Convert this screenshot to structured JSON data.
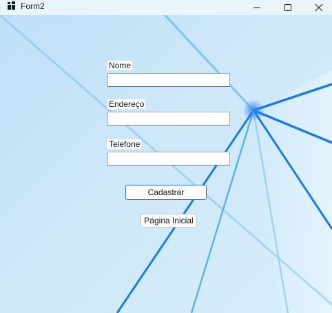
{
  "window": {
    "title": "Form2"
  },
  "form": {
    "fields": [
      {
        "label": "Nome",
        "value": ""
      },
      {
        "label": "Endereço",
        "value": ""
      },
      {
        "label": "Telefone",
        "value": ""
      }
    ],
    "submit_label": "Cadastrar",
    "home_label": "Página Inicial"
  },
  "icons": {
    "app": "app-icon",
    "minimize": "minimize-icon",
    "maximize": "maximize-icon",
    "close": "close-icon"
  },
  "colors": {
    "accent": "#2a73c4",
    "background": "#cfe8f7"
  }
}
